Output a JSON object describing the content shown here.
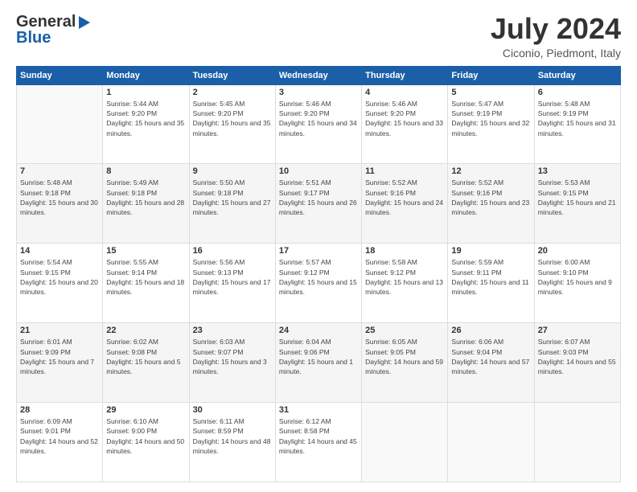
{
  "logo": {
    "line1": "General",
    "line2": "Blue"
  },
  "header": {
    "month": "July 2024",
    "location": "Ciconio, Piedmont, Italy"
  },
  "weekdays": [
    "Sunday",
    "Monday",
    "Tuesday",
    "Wednesday",
    "Thursday",
    "Friday",
    "Saturday"
  ],
  "weeks": [
    [
      {
        "day": "",
        "empty": true
      },
      {
        "day": "1",
        "sunrise": "5:44 AM",
        "sunset": "9:20 PM",
        "daylight": "15 hours and 35 minutes."
      },
      {
        "day": "2",
        "sunrise": "5:45 AM",
        "sunset": "9:20 PM",
        "daylight": "15 hours and 35 minutes."
      },
      {
        "day": "3",
        "sunrise": "5:46 AM",
        "sunset": "9:20 PM",
        "daylight": "15 hours and 34 minutes."
      },
      {
        "day": "4",
        "sunrise": "5:46 AM",
        "sunset": "9:20 PM",
        "daylight": "15 hours and 33 minutes."
      },
      {
        "day": "5",
        "sunrise": "5:47 AM",
        "sunset": "9:19 PM",
        "daylight": "15 hours and 32 minutes."
      },
      {
        "day": "6",
        "sunrise": "5:48 AM",
        "sunset": "9:19 PM",
        "daylight": "15 hours and 31 minutes."
      }
    ],
    [
      {
        "day": "7",
        "sunrise": "5:48 AM",
        "sunset": "9:18 PM",
        "daylight": "15 hours and 30 minutes."
      },
      {
        "day": "8",
        "sunrise": "5:49 AM",
        "sunset": "9:18 PM",
        "daylight": "15 hours and 28 minutes."
      },
      {
        "day": "9",
        "sunrise": "5:50 AM",
        "sunset": "9:18 PM",
        "daylight": "15 hours and 27 minutes."
      },
      {
        "day": "10",
        "sunrise": "5:51 AM",
        "sunset": "9:17 PM",
        "daylight": "15 hours and 26 minutes."
      },
      {
        "day": "11",
        "sunrise": "5:52 AM",
        "sunset": "9:16 PM",
        "daylight": "15 hours and 24 minutes."
      },
      {
        "day": "12",
        "sunrise": "5:52 AM",
        "sunset": "9:16 PM",
        "daylight": "15 hours and 23 minutes."
      },
      {
        "day": "13",
        "sunrise": "5:53 AM",
        "sunset": "9:15 PM",
        "daylight": "15 hours and 21 minutes."
      }
    ],
    [
      {
        "day": "14",
        "sunrise": "5:54 AM",
        "sunset": "9:15 PM",
        "daylight": "15 hours and 20 minutes."
      },
      {
        "day": "15",
        "sunrise": "5:55 AM",
        "sunset": "9:14 PM",
        "daylight": "15 hours and 18 minutes."
      },
      {
        "day": "16",
        "sunrise": "5:56 AM",
        "sunset": "9:13 PM",
        "daylight": "15 hours and 17 minutes."
      },
      {
        "day": "17",
        "sunrise": "5:57 AM",
        "sunset": "9:12 PM",
        "daylight": "15 hours and 15 minutes."
      },
      {
        "day": "18",
        "sunrise": "5:58 AM",
        "sunset": "9:12 PM",
        "daylight": "15 hours and 13 minutes."
      },
      {
        "day": "19",
        "sunrise": "5:59 AM",
        "sunset": "9:11 PM",
        "daylight": "15 hours and 11 minutes."
      },
      {
        "day": "20",
        "sunrise": "6:00 AM",
        "sunset": "9:10 PM",
        "daylight": "15 hours and 9 minutes."
      }
    ],
    [
      {
        "day": "21",
        "sunrise": "6:01 AM",
        "sunset": "9:09 PM",
        "daylight": "15 hours and 7 minutes."
      },
      {
        "day": "22",
        "sunrise": "6:02 AM",
        "sunset": "9:08 PM",
        "daylight": "15 hours and 5 minutes."
      },
      {
        "day": "23",
        "sunrise": "6:03 AM",
        "sunset": "9:07 PM",
        "daylight": "15 hours and 3 minutes."
      },
      {
        "day": "24",
        "sunrise": "6:04 AM",
        "sunset": "9:06 PM",
        "daylight": "15 hours and 1 minute."
      },
      {
        "day": "25",
        "sunrise": "6:05 AM",
        "sunset": "9:05 PM",
        "daylight": "14 hours and 59 minutes."
      },
      {
        "day": "26",
        "sunrise": "6:06 AM",
        "sunset": "9:04 PM",
        "daylight": "14 hours and 57 minutes."
      },
      {
        "day": "27",
        "sunrise": "6:07 AM",
        "sunset": "9:03 PM",
        "daylight": "14 hours and 55 minutes."
      }
    ],
    [
      {
        "day": "28",
        "sunrise": "6:09 AM",
        "sunset": "9:01 PM",
        "daylight": "14 hours and 52 minutes."
      },
      {
        "day": "29",
        "sunrise": "6:10 AM",
        "sunset": "9:00 PM",
        "daylight": "14 hours and 50 minutes."
      },
      {
        "day": "30",
        "sunrise": "6:11 AM",
        "sunset": "8:59 PM",
        "daylight": "14 hours and 48 minutes."
      },
      {
        "day": "31",
        "sunrise": "6:12 AM",
        "sunset": "8:58 PM",
        "daylight": "14 hours and 45 minutes."
      },
      {
        "day": "",
        "empty": true
      },
      {
        "day": "",
        "empty": true
      },
      {
        "day": "",
        "empty": true
      }
    ]
  ],
  "labels": {
    "sunrise": "Sunrise:",
    "sunset": "Sunset:",
    "daylight": "Daylight:"
  }
}
